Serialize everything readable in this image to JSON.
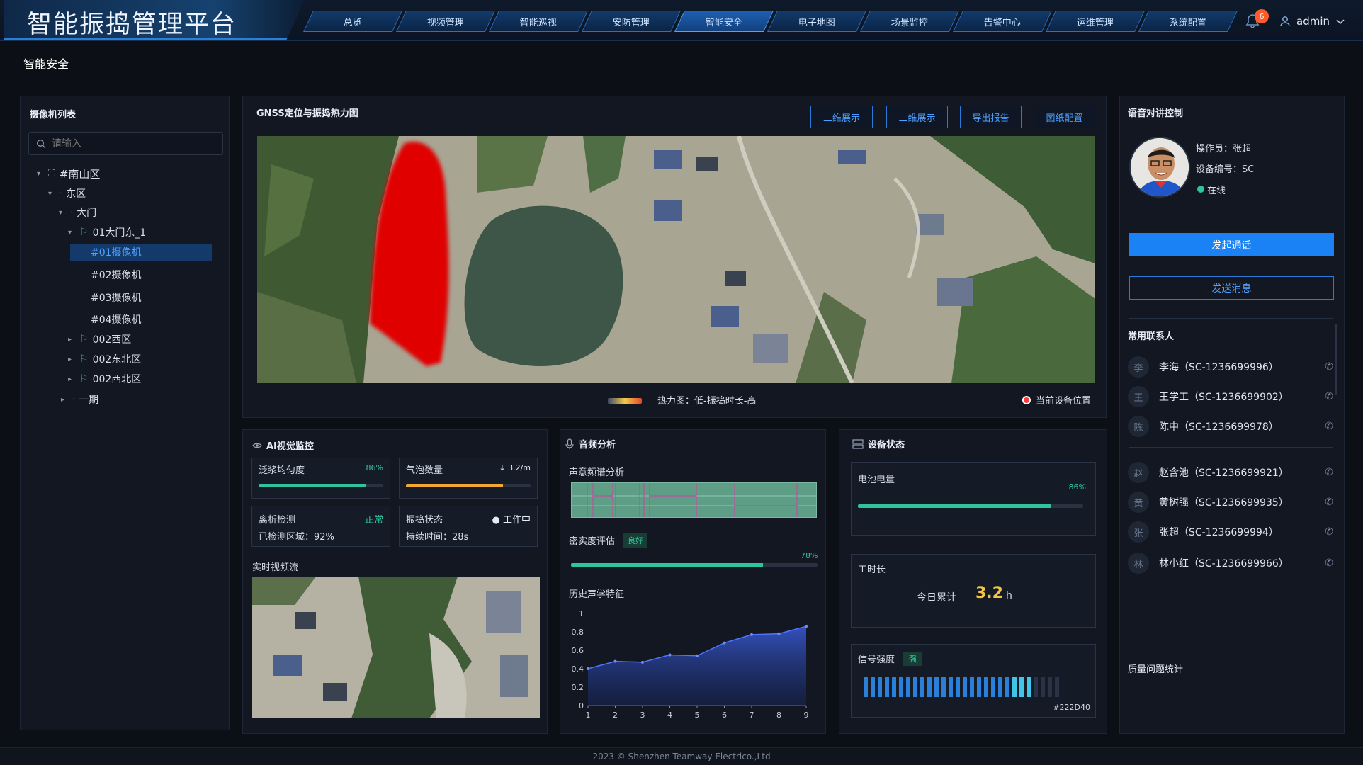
{
  "header": {
    "title": "智能振捣管理平台",
    "nav_tabs": [
      "总览",
      "视频管理",
      "智能巡视",
      "安防管理",
      "智能安全",
      "电子地图",
      "场景监控",
      "告警中心",
      "运维管理",
      "系统配置"
    ],
    "active_tab": "智能安全",
    "notification_count": "6",
    "username": "admin"
  },
  "page_subtitle": "智能安全",
  "camera_list": {
    "title": "摄像机列表",
    "search_placeholder": "请输入",
    "tree": [
      {
        "label": "#南山区",
        "arrow": "▾",
        "icon": "area-icon"
      },
      {
        "label": "东区",
        "arrow": "▾",
        "icon": "dot-icon"
      },
      {
        "label": "大门",
        "arrow": "▾",
        "icon": "dot-icon"
      },
      {
        "label": "01大门东_1",
        "arrow": "▾",
        "icon": "camera-group-icon"
      },
      {
        "label": "#01摄像机",
        "arrow": "",
        "icon": ""
      },
      {
        "label": "#02摄像机",
        "arrow": "",
        "icon": ""
      },
      {
        "label": "#03摄像机",
        "arrow": "",
        "icon": ""
      },
      {
        "label": "#04摄像机",
        "arrow": "",
        "icon": ""
      },
      {
        "label": "002西区",
        "arrow": "▸",
        "icon": "camera-group-icon"
      },
      {
        "label": "002东北区",
        "arrow": "▸",
        "icon": "camera-group-icon"
      },
      {
        "label": "002西北区",
        "arrow": "▸",
        "icon": "camera-group-icon"
      },
      {
        "label": "一期",
        "arrow": "▸",
        "icon": "dot-icon"
      }
    ]
  },
  "map_panel": {
    "title": "GNSS定位与振捣热力图",
    "buttons": [
      "二维展示",
      "二维展示",
      "导出报告",
      "图纸配置"
    ],
    "legend_text": "热力图：低-振捣时长-高",
    "device_position_label": "当前设备位置",
    "device_marker_color": "#ff3b3b"
  },
  "ai_panel": {
    "title": "AI视觉监控",
    "metrics": [
      {
        "label": "泛浆均匀度",
        "value": "86%",
        "fill": 0.86,
        "color": "#2fc49b"
      },
      {
        "label": "气泡数量",
        "value": "↓ 3.2/m",
        "fill": 0.78,
        "color": "#f0a733"
      },
      {
        "label": "离析检测",
        "value": "正常",
        "sub": "已检测区域：92%"
      },
      {
        "label": "振捣状态",
        "value": "● 工作中",
        "sub": "持续时间：28s"
      }
    ],
    "stream_label": "实时视频流"
  },
  "audio_panel": {
    "title": "音频分析",
    "spectrum_label": "声意频谱分析",
    "density_label": "密实度评估",
    "density_badge": "良好",
    "density_value": "78%",
    "density_fill": 0.78,
    "history_label": "历史声学特征"
  },
  "device_panel": {
    "title": "设备状态",
    "battery_label": "电池电量",
    "battery_value": "86%",
    "battery_fill": 0.86,
    "worktime_label": "工时长",
    "worktime_today": "今日累计",
    "worktime_value": "3.2",
    "worktime_unit": "h",
    "signal_label": "信号强度",
    "signal_badge": "强",
    "signal_color_label": "#222D40",
    "signal_level": 0.85
  },
  "voice_panel": {
    "title": "语音对讲控制",
    "operator": "操作员：张超",
    "device_no": "设备编号：SC",
    "status": "在线",
    "call_button": "发起通话",
    "message_button": "发送消息",
    "contacts_title": "常用联系人",
    "contacts": [
      {
        "initial": "李",
        "name": "李海（SC-1236699996）"
      },
      {
        "initial": "王",
        "name": "王学工（SC-1236699902）"
      },
      {
        "initial": "陈",
        "name": "陈中（SC-1236699978）"
      },
      {
        "initial": "赵",
        "name": "赵含池（SC-1236699921）"
      },
      {
        "initial": "黄",
        "name": "黄树强（SC-1236699935）"
      },
      {
        "initial": "张",
        "name": "张超（SC-1236699994）"
      },
      {
        "initial": "林",
        "name": "林小红（SC-1236699966）"
      }
    ],
    "quality_title": "质量问题统计"
  },
  "chart_data": {
    "type": "area",
    "x": [
      1,
      2,
      3,
      4,
      5,
      6,
      7,
      8,
      9
    ],
    "values": [
      0.4,
      0.48,
      0.47,
      0.55,
      0.54,
      0.68,
      0.77,
      0.78,
      0.86
    ],
    "ylim": [
      0,
      1
    ],
    "yticks": [
      "0",
      "0.2",
      "0.4",
      "0.6",
      "0.8",
      "1"
    ],
    "xticks": [
      "1",
      "2",
      "3",
      "4",
      "5",
      "6",
      "7",
      "8",
      "9"
    ],
    "color": "#3a5cd8"
  },
  "footer": "2023 © Shenzhen Teamway Electrico.,Ltd"
}
